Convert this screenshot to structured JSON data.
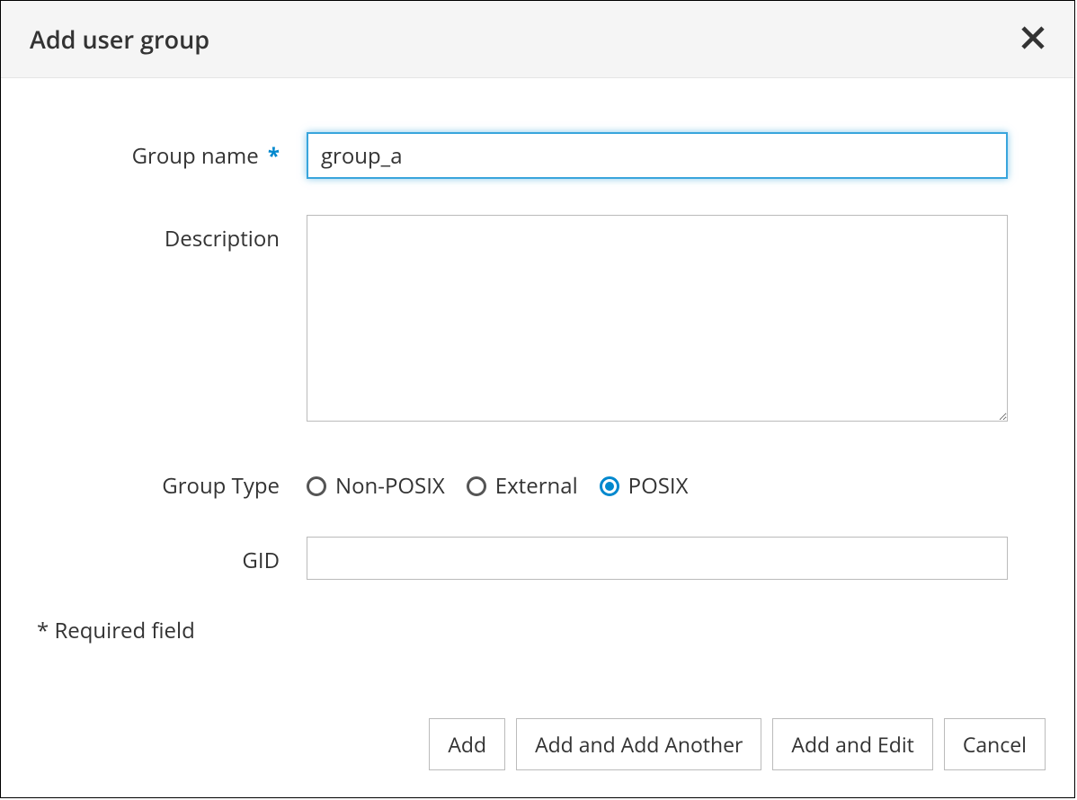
{
  "dialog": {
    "title": "Add user group",
    "close_icon": "✕"
  },
  "form": {
    "group_name": {
      "label": "Group name",
      "required": true,
      "value": "group_a"
    },
    "description": {
      "label": "Description",
      "value": ""
    },
    "group_type": {
      "label": "Group Type",
      "options": [
        {
          "label": "Non-POSIX",
          "selected": false
        },
        {
          "label": "External",
          "selected": false
        },
        {
          "label": "POSIX",
          "selected": true
        }
      ]
    },
    "gid": {
      "label": "GID",
      "value": ""
    },
    "required_note": "* Required field"
  },
  "buttons": {
    "add": "Add",
    "add_another": "Add and Add Another",
    "add_edit": "Add and Edit",
    "cancel": "Cancel"
  }
}
